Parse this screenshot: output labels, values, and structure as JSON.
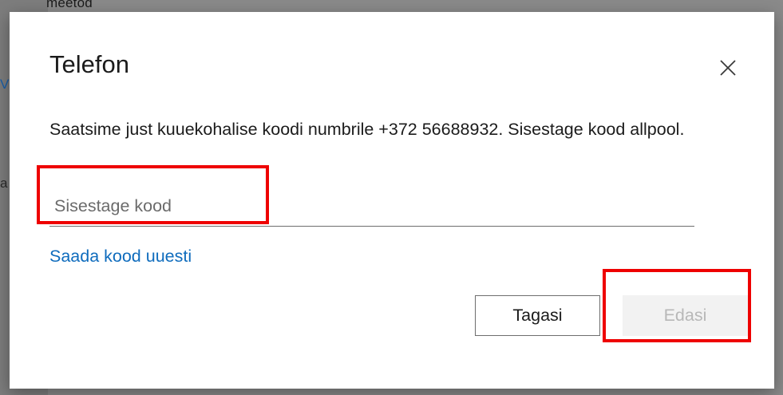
{
  "backdrop": {
    "text": "meetod"
  },
  "dialog": {
    "title": "Telefon",
    "message": "Saatsime just kuuekohalise koodi numbrile +372 56688932. Sisestage kood allpool.",
    "code_input": {
      "value": "",
      "placeholder": "Sisestage kood"
    },
    "resend_link": "Saada kood uuesti",
    "back_button": "Tagasi",
    "next_button": "Edasi",
    "close_icon": "close-icon"
  },
  "colors": {
    "link": "#0f6cbd",
    "highlight": "#ee0000",
    "disabled_text": "#b8b8b8",
    "disabled_bg": "#f2f2f2"
  }
}
